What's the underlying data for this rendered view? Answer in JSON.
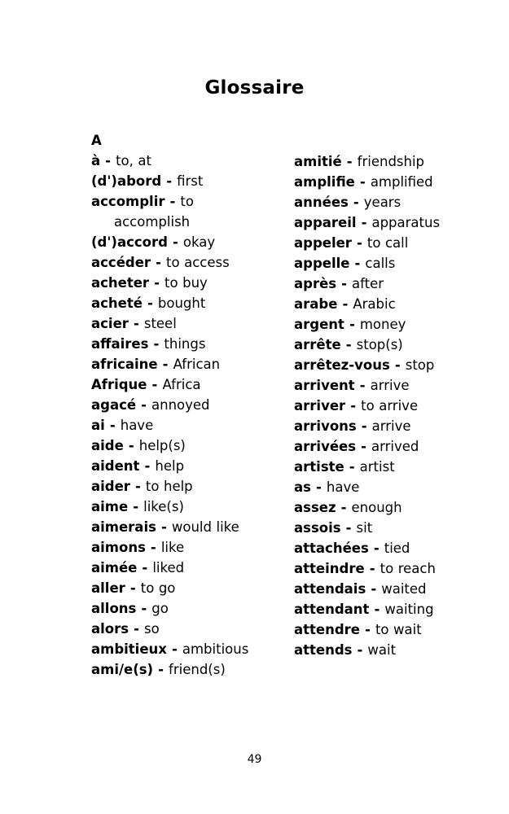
{
  "document": {
    "title": "Glossaire",
    "page_number": "49"
  },
  "section": {
    "letter": "A"
  },
  "separator": "-",
  "columns": {
    "left": [
      {
        "term": "à",
        "definition": "to, at"
      },
      {
        "term": "(d')abord",
        "definition": "first"
      },
      {
        "term": "accomplir",
        "definition": "to accomplish"
      },
      {
        "term": "(d')accord",
        "definition": "okay"
      },
      {
        "term": "accéder",
        "definition": "to access"
      },
      {
        "term": "acheter",
        "definition": "to buy"
      },
      {
        "term": "acheté",
        "definition": "bought"
      },
      {
        "term": "acier",
        "definition": "steel"
      },
      {
        "term": "affaires",
        "definition": "things"
      },
      {
        "term": "africaine",
        "definition": "African"
      },
      {
        "term": "Afrique",
        "definition": "Africa"
      },
      {
        "term": "agacé",
        "definition": "annoyed"
      },
      {
        "term": "ai",
        "definition": "have"
      },
      {
        "term": "aide",
        "definition": "help(s)"
      },
      {
        "term": "aident",
        "definition": "help"
      },
      {
        "term": "aider",
        "definition": "to help"
      },
      {
        "term": "aime",
        "definition": "like(s)"
      },
      {
        "term": "aimerais",
        "definition": "would like"
      },
      {
        "term": "aimons",
        "definition": "like"
      },
      {
        "term": "aimée",
        "definition": "liked"
      },
      {
        "term": "aller",
        "definition": "to go"
      },
      {
        "term": "allons",
        "definition": "go"
      },
      {
        "term": "alors",
        "definition": "so"
      },
      {
        "term": "ambitieux",
        "definition": "ambitious"
      },
      {
        "term": "ami/e(s)",
        "definition": "friend(s)"
      }
    ],
    "right": [
      {
        "term": "amitié",
        "definition": "friendship"
      },
      {
        "term": "amplifie",
        "definition": "amplified"
      },
      {
        "term": "années",
        "definition": "years"
      },
      {
        "term": "appareil",
        "definition": "apparatus"
      },
      {
        "term": "appeler",
        "definition": "to call"
      },
      {
        "term": "appelle",
        "definition": "calls"
      },
      {
        "term": "après",
        "definition": "after"
      },
      {
        "term": "arabe",
        "definition": "Arabic"
      },
      {
        "term": "argent",
        "definition": "money"
      },
      {
        "term": "arrête",
        "definition": "stop(s)"
      },
      {
        "term": "arrêtez-vous",
        "definition": "stop"
      },
      {
        "term": "arrivent",
        "definition": "arrive"
      },
      {
        "term": "arriver",
        "definition": "to arrive"
      },
      {
        "term": "arrivons",
        "definition": "arrive"
      },
      {
        "term": "arrivées",
        "definition": "arrived"
      },
      {
        "term": "artiste",
        "definition": "artist"
      },
      {
        "term": "as",
        "definition": "have"
      },
      {
        "term": "assez",
        "definition": "enough"
      },
      {
        "term": "assois",
        "definition": "sit"
      },
      {
        "term": "attachées",
        "definition": "tied"
      },
      {
        "term": "atteindre",
        "definition": "to reach"
      },
      {
        "term": "attendais",
        "definition": "waited"
      },
      {
        "term": "attendant",
        "definition": "waiting"
      },
      {
        "term": "attendre",
        "definition": "to wait"
      },
      {
        "term": "attends",
        "definition": "wait"
      }
    ]
  }
}
